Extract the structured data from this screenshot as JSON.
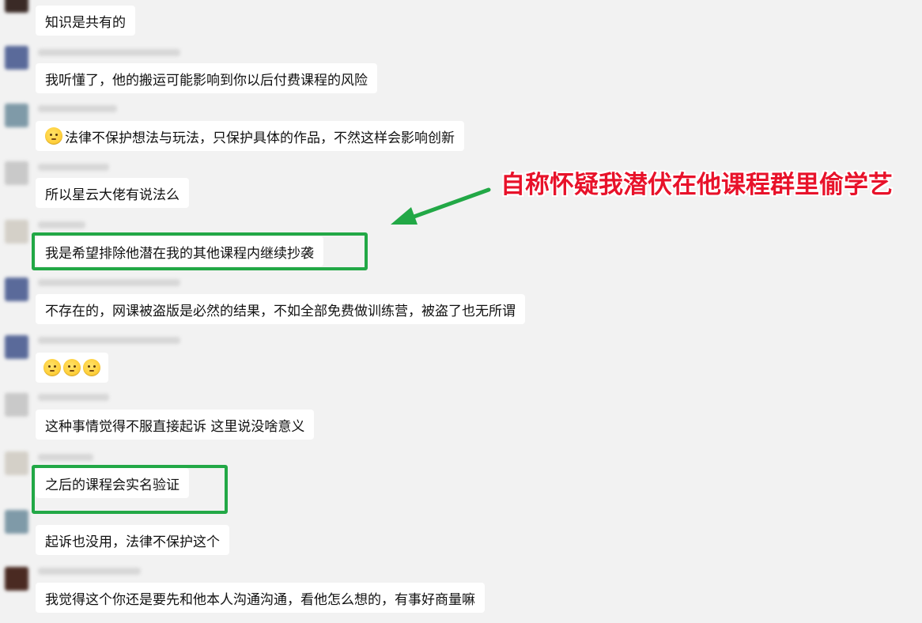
{
  "messages": [
    {
      "text": "知识是共有的"
    },
    {
      "text": "我听懂了，他的搬运可能影响到你以后付费课程的风险"
    },
    {
      "text": "法律不保护想法与玩法，只保护具体的作品，不然这样会影响创新",
      "emoji_prefix": "thinking-face"
    },
    {
      "text": "所以星云大佬有说法么"
    },
    {
      "text": "我是希望排除他潜在我的其他课程内继续抄袭"
    },
    {
      "text": "不存在的，网课被盗版是必然的结果，不如全部免费做训练营，被盗了也无所谓"
    },
    {
      "text": "",
      "emoji_count": 3,
      "emoji_name": "thinking-face"
    },
    {
      "text": "这种事情觉得不服直接起诉 这里说没啥意义"
    },
    {
      "text": "之后的课程会实名验证"
    },
    {
      "text": "起诉也没用，法律不保护这个"
    },
    {
      "text": "我觉得这个你还是要先和他本人沟通沟通，看他怎么想的，有事好商量嘛"
    }
  ],
  "annotation": {
    "text": "自称怀疑我潜伏在他课程群里偷学艺",
    "color": "#e8122a",
    "highlight_color": "#22a846"
  }
}
